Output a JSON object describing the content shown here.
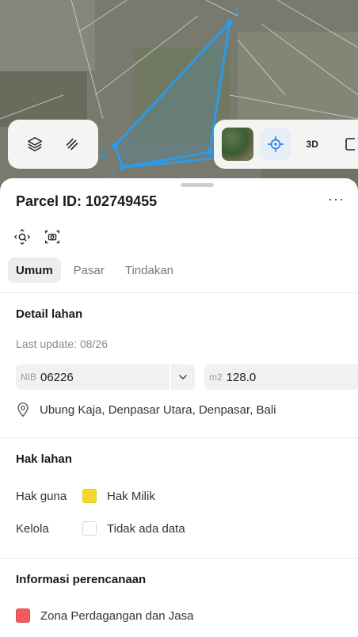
{
  "map": {
    "vertex_labels": [
      "1",
      "2",
      "3"
    ]
  },
  "toolbar": {
    "layers_icon": "layers-icon",
    "draw_icon": "draw-icon",
    "locate_icon": "crosshair-icon",
    "btn_3d": "3D"
  },
  "parcel": {
    "title": "Parcel ID: 102749455",
    "more_label": "···"
  },
  "tabs": [
    {
      "label": "Umum",
      "active": true
    },
    {
      "label": "Pasar",
      "active": false
    },
    {
      "label": "Tindakan",
      "active": false
    }
  ],
  "detail": {
    "title": "Detail lahan",
    "last_update": "Last update: 08/26",
    "nib_prefix": "NIB",
    "nib_value": "06226",
    "area_prefix": "m2",
    "area_value": "128.0",
    "address": "Ubung Kaja, Denpasar Utara, Denpasar, Bali"
  },
  "hak": {
    "title": "Hak lahan",
    "rows": [
      {
        "label": "Hak guna",
        "value": "Hak Milik",
        "color": "#f5d92a"
      },
      {
        "label": "Kelola",
        "value": "Tidak ada data",
        "color": "#ffffff"
      }
    ]
  },
  "planning": {
    "title": "Informasi perencanaan",
    "zone": "Zona Perdagangan dan Jasa",
    "zone_color": "#f05b5b"
  },
  "colors": {
    "parcel_outline": "#2b9bea",
    "accent": "#2b7de9"
  }
}
